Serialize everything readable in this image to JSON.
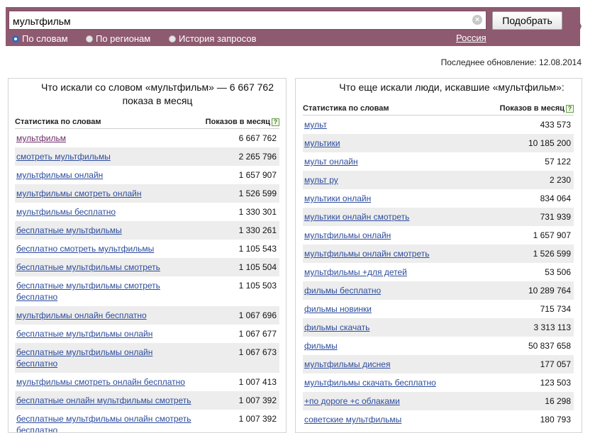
{
  "search": {
    "value": "мультфильм",
    "submit_label": "Подобрать",
    "clear_glyph": "×"
  },
  "modes": [
    {
      "label": "По словам",
      "selected": true
    },
    {
      "label": "По регионам",
      "selected": false
    },
    {
      "label": "История запросов",
      "selected": false
    }
  ],
  "region": "Россия",
  "update": "Последнее обновление: 12.08.2014",
  "left_panel": {
    "title": "Что искали со словом «мультфильм» — 6 667 762 показа в месяц",
    "col_words": "Статистика по словам",
    "col_shows": "Показов в месяц",
    "help_glyph": "?",
    "rows": [
      {
        "phrase": "мультфильм",
        "count": "6 667 762"
      },
      {
        "phrase": "смотреть мультфильмы",
        "count": "2 265 796"
      },
      {
        "phrase": "мультфильмы онлайн",
        "count": "1 657 907"
      },
      {
        "phrase": "мультфильмы смотреть онлайн",
        "count": "1 526 599"
      },
      {
        "phrase": "мультфильмы бесплатно",
        "count": "1 330 301"
      },
      {
        "phrase": "бесплатные мультфильмы",
        "count": "1 330 261"
      },
      {
        "phrase": "бесплатно смотреть мультфильмы",
        "count": "1 105 543"
      },
      {
        "phrase": "бесплатные мультфильмы смотреть",
        "count": "1 105 504"
      },
      {
        "phrase": "бесплатные мультфильмы смотреть бесплатно",
        "count": "1 105 503"
      },
      {
        "phrase": "мультфильмы онлайн бесплатно",
        "count": "1 067 696"
      },
      {
        "phrase": "бесплатные мультфильмы онлайн",
        "count": "1 067 677"
      },
      {
        "phrase": "бесплатные мультфильмы онлайн бесплатно",
        "count": "1 067 673"
      },
      {
        "phrase": "мультфильмы смотреть онлайн бесплатно",
        "count": "1 007 413"
      },
      {
        "phrase": "бесплатные онлайн мультфильмы смотреть",
        "count": "1 007 392"
      },
      {
        "phrase": "бесплатные мультфильмы онлайн смотреть бесплатно",
        "count": "1 007 392"
      }
    ]
  },
  "right_panel": {
    "title": "Что еще искали люди, искавшие «мультфильм»:",
    "col_words": "Статистика по словам",
    "col_shows": "Показов в месяц",
    "help_glyph": "?",
    "rows": [
      {
        "phrase": "мульт",
        "count": "433 573"
      },
      {
        "phrase": "мультики",
        "count": "10 185 200"
      },
      {
        "phrase": "мульт онлайн",
        "count": "57 122"
      },
      {
        "phrase": "мульт ру",
        "count": "2 230"
      },
      {
        "phrase": "мультики онлайн",
        "count": "834 064"
      },
      {
        "phrase": "мультики онлайн смотреть",
        "count": "731 939"
      },
      {
        "phrase": "мультфильмы онлайн",
        "count": "1 657 907"
      },
      {
        "phrase": "мультфильмы онлайн смотреть",
        "count": "1 526 599"
      },
      {
        "phrase": "мультфильмы +для детей",
        "count": "53 506"
      },
      {
        "phrase": "фильмы бесплатно",
        "count": "10 289 764"
      },
      {
        "phrase": "фильмы новинки",
        "count": "715 734"
      },
      {
        "phrase": "фильмы скачать",
        "count": "3 313 113"
      },
      {
        "phrase": "фильмы",
        "count": "50 837 658"
      },
      {
        "phrase": "мультфильмы диснея",
        "count": "177 057"
      },
      {
        "phrase": "мультфильмы скачать бесплатно",
        "count": "123 503"
      },
      {
        "phrase": "+по дороге +с облаками",
        "count": "16 298"
      },
      {
        "phrase": "советские мультфильмы",
        "count": "180 793"
      }
    ]
  }
}
